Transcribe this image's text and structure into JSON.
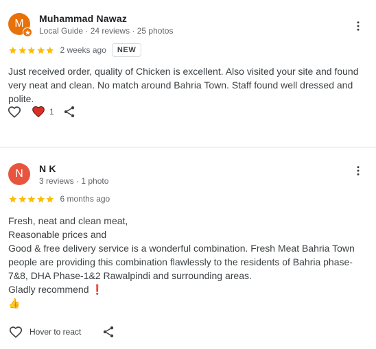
{
  "reviews": [
    {
      "avatar_letter": "M",
      "name": "Muhammad Nawaz",
      "subtitle": "Local Guide · 24 reviews · 25 photos",
      "rating": 5,
      "date": "2 weeks ago",
      "badge": "NEW",
      "text_lines": [
        "Just received order, quality of Chicken is excellent. Also visited your site and found",
        "very neat and clean. No match around Bahria Town. Staff found well dressed and",
        "polite."
      ],
      "like_count": "1"
    },
    {
      "avatar_letter": "N",
      "name": "N K",
      "subtitle": "3 reviews · 1 photo",
      "rating": 5,
      "date": "6 months ago",
      "text_lines": [
        "Fresh, neat and clean meat,",
        "Reasonable prices and",
        "Good & free delivery service is a wonderful combination. Fresh Meat Bahria Town",
        "people are providing this combination flawlessly to the residents of Bahria phase-",
        "7&8, DHA Phase-1&2 Rawalpindi and surrounding areas.",
        "Gladly recommend ❗"
      ],
      "emoji": "👍",
      "hover_label": "Hover to react"
    }
  ],
  "colors": {
    "star": "#fbbc04",
    "avatar_1": "#e8710a",
    "avatar_2": "#e8553e",
    "heart_reaction": "#d93025",
    "secondary_text": "#5f6368"
  },
  "icons": {
    "more": "more-vert-icon",
    "like": "heart-outline-icon",
    "reaction": "heart-filled-icon",
    "share": "share-icon",
    "local_guide": "local-guide-star-icon"
  }
}
